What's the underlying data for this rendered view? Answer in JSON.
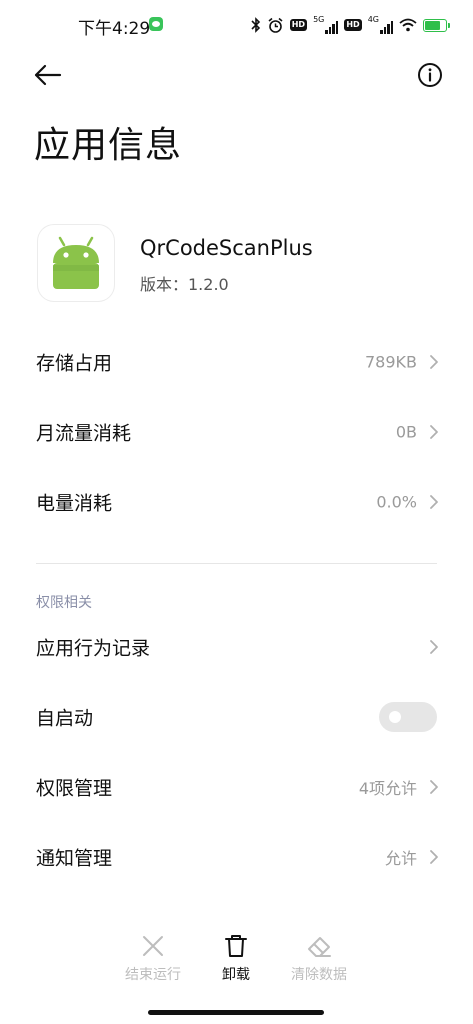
{
  "status_bar": {
    "time": "下午4:29",
    "network_1": "5G",
    "network_2": "4G",
    "hd_label": "HD",
    "icons": [
      "bluetooth-icon",
      "alarm-icon",
      "hd-icon",
      "signal-icon",
      "hd-icon",
      "signal-icon",
      "wifi-icon",
      "battery-charging-icon"
    ],
    "battery_color": "#2fbf4a"
  },
  "header": {
    "title": "应用信息",
    "back_icon": "back-arrow-icon",
    "info_icon": "info-icon"
  },
  "app": {
    "name": "QrCodeScanPlus",
    "version": "版本：1.2.0",
    "icon": "android-icon",
    "icon_color": "#8bc34a"
  },
  "rows": [
    {
      "label": "存储占用",
      "value": "789KB"
    },
    {
      "label": "月流量消耗",
      "value": "0B"
    },
    {
      "label": "电量消耗",
      "value": "0.0%"
    }
  ],
  "permissions_section": {
    "label": "权限相关",
    "rows": [
      {
        "label": "应用行为记录",
        "value": ""
      },
      {
        "label": "自启动",
        "toggle": false
      },
      {
        "label": "权限管理",
        "value": "4项允许"
      },
      {
        "label": "通知管理",
        "value": "允许"
      }
    ]
  },
  "bottom_actions": [
    {
      "label": "结束运行",
      "icon": "close-icon",
      "enabled": false
    },
    {
      "label": "卸载",
      "icon": "trash-icon",
      "enabled": true
    },
    {
      "label": "清除数据",
      "icon": "eraser-icon",
      "enabled": false
    }
  ]
}
